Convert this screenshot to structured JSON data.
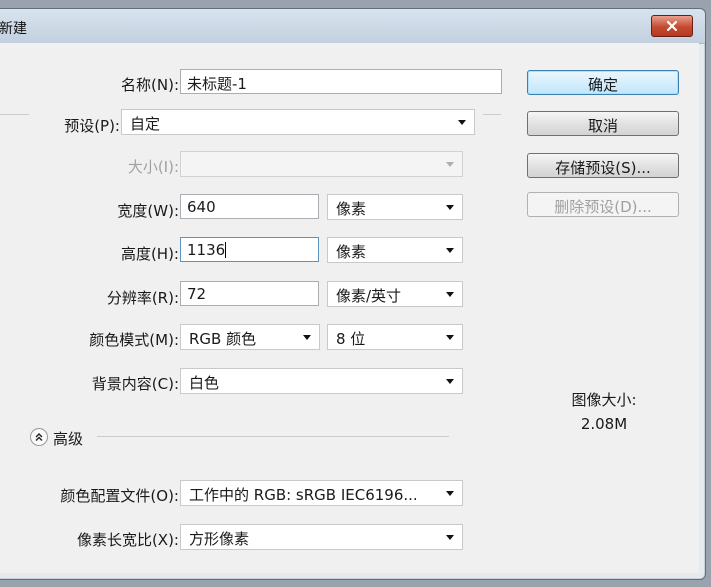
{
  "window": {
    "title": "新建"
  },
  "form": {
    "name": {
      "label": "名称(N):",
      "value": "未标题-1"
    },
    "preset": {
      "label": "预设(P):",
      "value": "自定"
    },
    "size": {
      "label": "大小(I):",
      "value": ""
    },
    "width": {
      "label": "宽度(W):",
      "value": "640",
      "unit": "像素"
    },
    "height": {
      "label": "高度(H):",
      "value": "1136",
      "unit": "像素"
    },
    "resolution": {
      "label": "分辨率(R):",
      "value": "72",
      "unit": "像素/英寸"
    },
    "color_mode": {
      "label": "颜色模式(M):",
      "value": "RGB 颜色",
      "depth": "8 位"
    },
    "background": {
      "label": "背景内容(C):",
      "value": "白色"
    },
    "advanced": {
      "label": "高级"
    },
    "color_profile": {
      "label": "颜色配置文件(O):",
      "value": "工作中的 RGB: sRGB IEC6196..."
    },
    "pixel_aspect": {
      "label": "像素长宽比(X):",
      "value": "方形像素"
    }
  },
  "buttons": {
    "ok": "确定",
    "cancel": "取消",
    "save_preset": "存储预设(S)...",
    "delete_preset": "删除预设(D)..."
  },
  "image_size": {
    "label": "图像大小:",
    "value": "2.08M"
  }
}
